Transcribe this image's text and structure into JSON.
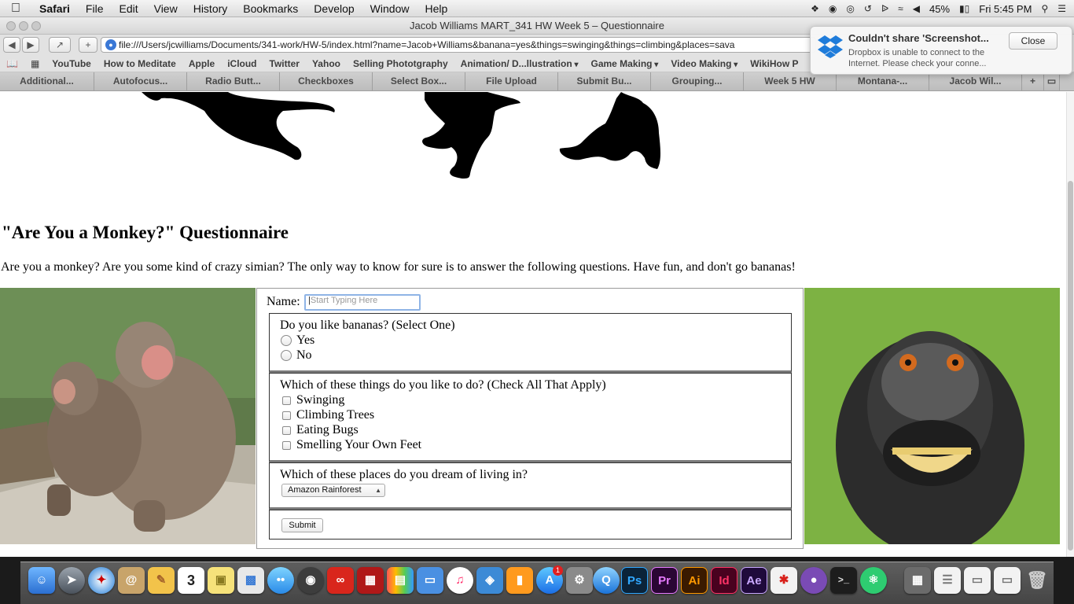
{
  "menubar": {
    "app": "Safari",
    "items": [
      "File",
      "Edit",
      "View",
      "History",
      "Bookmarks",
      "Develop",
      "Window",
      "Help"
    ],
    "battery": "45%",
    "clock": "Fri 5:45 PM"
  },
  "window": {
    "title": "Jacob Williams MART_341 HW Week 5 – Questionnaire",
    "url": "file:///Users/jcwilliams/Documents/341-work/HW-5/index.html?name=Jacob+Williams&banana=yes&things=swinging&things=climbing&places=sava"
  },
  "bookmarks": [
    {
      "label": "YouTube",
      "dropdown": false
    },
    {
      "label": "How to Meditate",
      "dropdown": false
    },
    {
      "label": "Apple",
      "dropdown": false
    },
    {
      "label": "iCloud",
      "dropdown": false
    },
    {
      "label": "Twitter",
      "dropdown": false
    },
    {
      "label": "Yahoo",
      "dropdown": false
    },
    {
      "label": "Selling Phototgraphy",
      "dropdown": false
    },
    {
      "label": "Animation/ D...llustration",
      "dropdown": true
    },
    {
      "label": "Game Making",
      "dropdown": true
    },
    {
      "label": "Video Making",
      "dropdown": true
    },
    {
      "label": "WikiHow P",
      "dropdown": false
    }
  ],
  "tabs": [
    "Additional...",
    "Autofocus...",
    "Radio Butt...",
    "Checkboxes",
    "Select Box...",
    "File Upload",
    "Submit Bu...",
    "Grouping...",
    "Week 5 HW",
    "Montana-...",
    "Jacob Wil..."
  ],
  "notification": {
    "title": "Couldn't share 'Screenshot...",
    "body": "Dropbox is unable to connect to the Internet. Please check your conne...",
    "close_label": "Close"
  },
  "page": {
    "heading": "\"Are You a Monkey?\" Questionnaire",
    "intro": "Are you a monkey? Are you some kind of crazy simian? The only way to know for sure is to answer the following questions. Have fun, and don't go bananas!",
    "form": {
      "name_label": "Name:",
      "name_placeholder": "Start Typing Here",
      "banana_question": "Do you like bananas? (Select One)",
      "banana_options": [
        "Yes",
        "No"
      ],
      "things_question": "Which of these things do you like to do? (Check All That Apply)",
      "things_options": [
        "Swinging",
        "Climbing Trees",
        "Eating Bugs",
        "Smelling Your Own Feet"
      ],
      "places_question": "Which of these places do you dream of living in?",
      "places_selected": "Amazon Rainforest",
      "submit_label": "Submit"
    }
  },
  "dock": {
    "labeled_icons": [
      {
        "name": "photoshop",
        "label": "Ps",
        "color": "#0b2339",
        "fg": "#31a8ff"
      },
      {
        "name": "premiere",
        "label": "Pr",
        "color": "#2a0634",
        "fg": "#e67bff"
      },
      {
        "name": "illustrator",
        "label": "Ai",
        "color": "#3a1a00",
        "fg": "#ff9a00"
      },
      {
        "name": "indesign",
        "label": "Id",
        "color": "#49021f",
        "fg": "#ff3366"
      },
      {
        "name": "after-effects",
        "label": "Ae",
        "color": "#1f0a3b",
        "fg": "#c9a8ff"
      }
    ],
    "calendar_day": "3",
    "appstore_badge": "1"
  }
}
